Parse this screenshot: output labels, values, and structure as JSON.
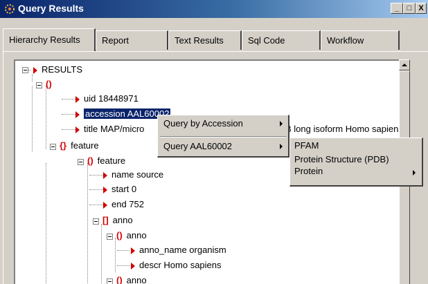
{
  "window": {
    "title": "Query Results",
    "buttons": {
      "minimize": "_",
      "maximize": "□",
      "close": "X"
    }
  },
  "tabs": [
    {
      "label": "Hierarchy Results",
      "active": true
    },
    {
      "label": "Report"
    },
    {
      "label": "Text Results"
    },
    {
      "label": "Sql Code"
    },
    {
      "label": "Workflow"
    }
  ],
  "tree": {
    "root": "RESULTS",
    "paren": "()",
    "curly": "{}",
    "square": "[]",
    "uid": "uid  18448971",
    "accession": "accession  AAL60002",
    "title_left": "title  MAP/micro",
    "title_right": "B long isoform  Homo sapiens",
    "feature1": "feature",
    "feature2": "feature",
    "name_source": "name  source",
    "start": "start  0",
    "end": "end  752",
    "anno1": "anno",
    "anno2": "anno",
    "anno_name": "anno_name  organism",
    "descr": "descr  Homo sapiens",
    "anno3": "anno"
  },
  "context_menu": {
    "item1": "Query by Accession",
    "item2": "Query AAL60002"
  },
  "submenu": {
    "item1": "PFAM",
    "item2": "Protein Structure (PDB)",
    "item3": "Protein"
  },
  "colors": {
    "titlebar": "#0a246a",
    "accent_red": "#d40000",
    "selection": "#0a246a"
  }
}
